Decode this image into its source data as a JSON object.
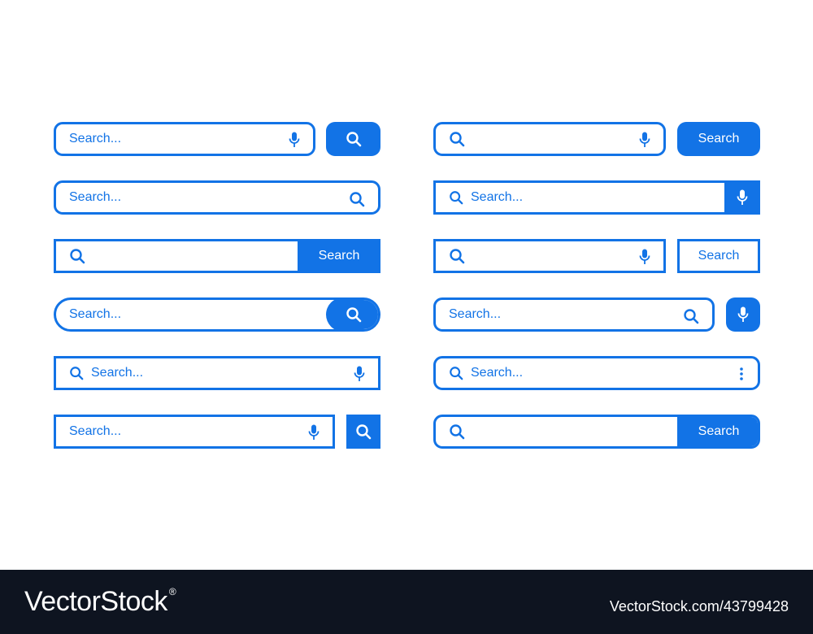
{
  "colors": {
    "accent": "#1273E6",
    "footer_bg": "#0E1420",
    "footer_text": "#FFFFFF"
  },
  "search_bars": {
    "placeholder": "Search...",
    "button_label": "Search"
  },
  "icons": [
    "search-icon",
    "mic-icon",
    "more-vertical-icon"
  ],
  "footer": {
    "brand": "VectorStock",
    "registered_mark": "®",
    "image_id": "VectorStock.com/43799428"
  }
}
